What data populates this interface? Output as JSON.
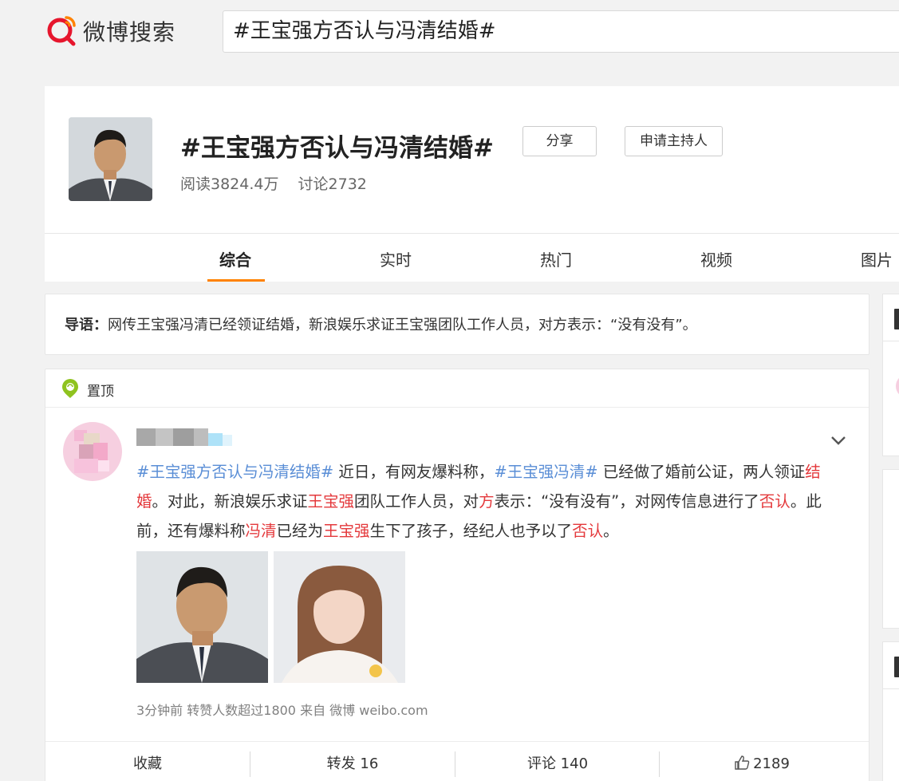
{
  "logo": {
    "text": "微博搜索",
    "brand_color": "#e6162d"
  },
  "search": {
    "value": "#王宝强方否认与冯清结婚#"
  },
  "topic": {
    "title": "#王宝强方否认与冯清结婚#",
    "share_label": "分享",
    "host_label": "申请主持人",
    "reads": "阅读3824.4万",
    "discussions": "讨论2732"
  },
  "tabs": [
    {
      "label": "综合",
      "active": true
    },
    {
      "label": "实时"
    },
    {
      "label": "热门"
    },
    {
      "label": "视频"
    },
    {
      "label": "图片"
    }
  ],
  "intro": {
    "label": "导语：",
    "text": "网传王宝强冯清已经领证结婚，新浪娱乐求证王宝强团队工作人员，对方表示：“没有没有”。"
  },
  "post": {
    "pin_label": "置顶",
    "body": {
      "tag1": "#王宝强方否认与冯清结婚#",
      "p1": " 近日，有网友爆料称，",
      "tag2": "#王宝强冯清#",
      "p2": " 已经做了婚前公证，两人领证",
      "k1": "结婚",
      "p3": "。对此，新浪娱乐求证",
      "k2": "王宝强",
      "p4": "团队工作人员，对",
      "k3": "方",
      "p5": "表示：“没有没有”，对网传信息进行了",
      "k4": "否认",
      "p6": "。此前，还有爆料称",
      "k5": "冯清",
      "p7": "已经为",
      "k6": "王宝强",
      "p8": "生下了孩子，经纪人也予以了",
      "k7": "否认",
      "p9": "。"
    },
    "meta": "3分钟前 转赞人数超过1800  来自 微博 weibo.com",
    "actions": {
      "favorite": "收藏",
      "repost": "转发 16",
      "comment": "评论 140",
      "like": "2189"
    }
  },
  "colors": {
    "tab_accent": "#ff8200",
    "tag_orange": "#eb7350",
    "tag_blue": "#5a8ed6",
    "keyword_red": "#e4393c",
    "pin_green": "#8fc31f"
  }
}
